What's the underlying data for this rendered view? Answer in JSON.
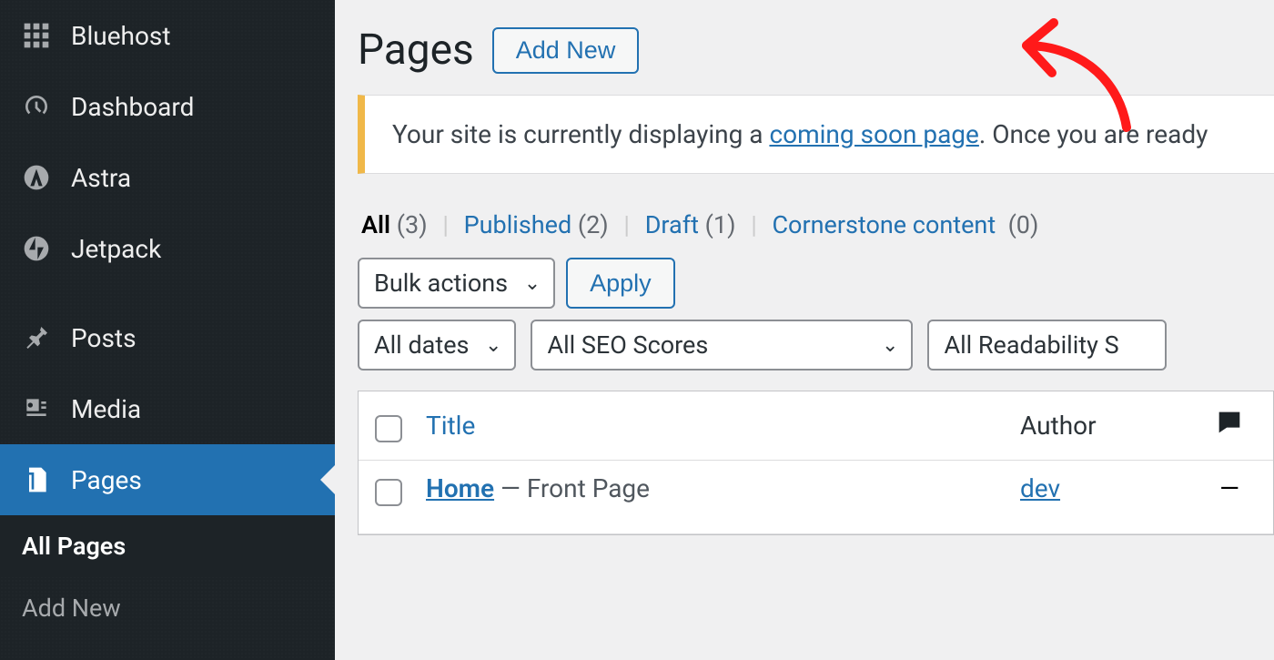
{
  "sidebar": {
    "items": [
      {
        "label": "Bluehost",
        "icon": "grid"
      },
      {
        "label": "Dashboard",
        "icon": "gauge"
      },
      {
        "label": "Astra",
        "icon": "astra"
      },
      {
        "label": "Jetpack",
        "icon": "jetpack"
      },
      {
        "label": "Posts",
        "icon": "pin"
      },
      {
        "label": "Media",
        "icon": "media"
      },
      {
        "label": "Pages",
        "icon": "pages"
      }
    ],
    "submenu": [
      {
        "label": "All Pages",
        "current": true
      },
      {
        "label": "Add New",
        "current": false
      }
    ]
  },
  "header": {
    "title": "Pages",
    "add_new_label": "Add New"
  },
  "notice": {
    "prefix": "Your site is currently displaying a ",
    "link_text": "coming soon page",
    "suffix": ". Once you are ready"
  },
  "filters": {
    "views": [
      {
        "label": "All",
        "count": "(3)",
        "current": true
      },
      {
        "label": "Published",
        "count": "(2)",
        "current": false
      },
      {
        "label": "Draft",
        "count": "(1)",
        "current": false
      },
      {
        "label": "Cornerstone content",
        "count": "(0)",
        "current": false
      }
    ],
    "bulk_actions_label": "Bulk actions",
    "apply_label": "Apply",
    "dates_label": "All dates",
    "seo_scores_label": "All SEO Scores",
    "readability_label": "All Readability S"
  },
  "table": {
    "columns": {
      "title": "Title",
      "author": "Author"
    },
    "rows": [
      {
        "title": "Home",
        "suffix": " — Front Page",
        "author": "dev",
        "comments": "—"
      }
    ]
  }
}
